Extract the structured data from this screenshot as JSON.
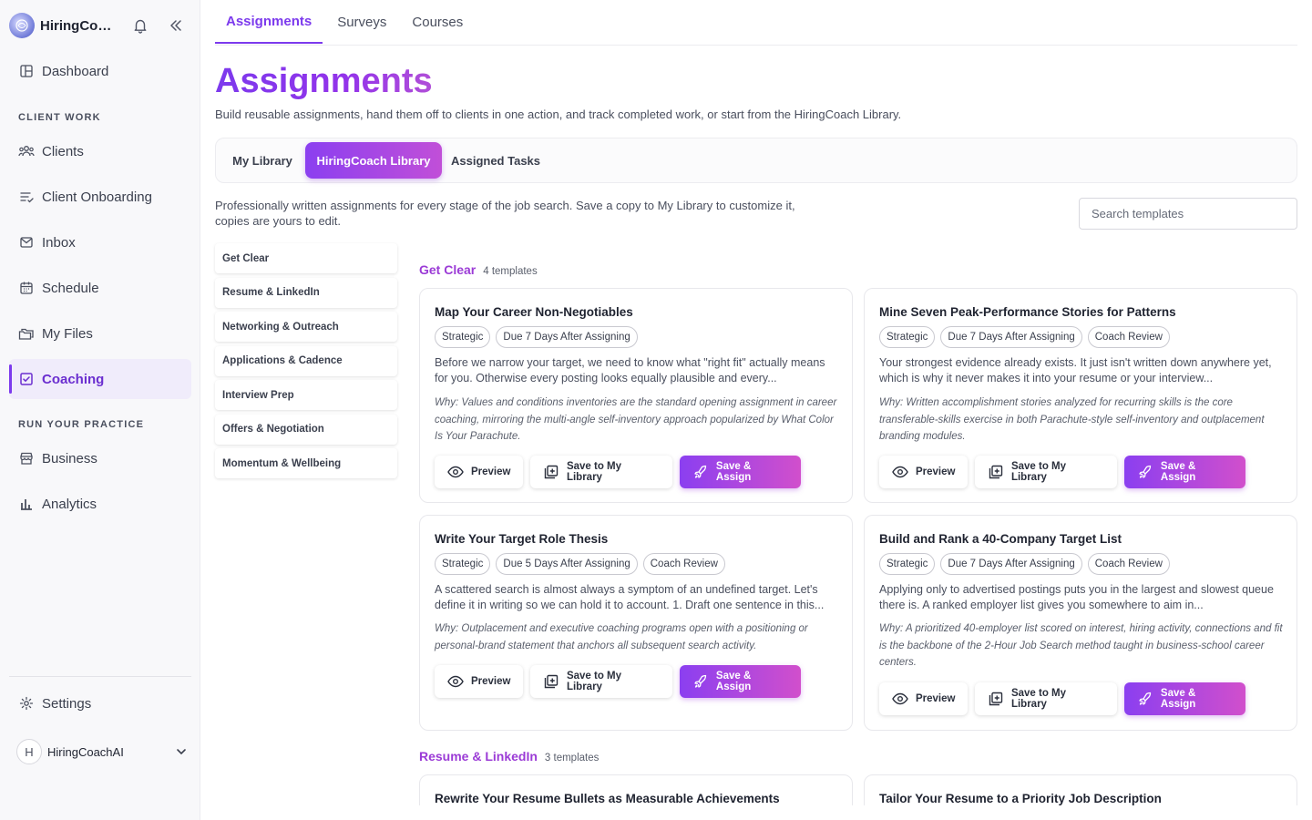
{
  "app": {
    "name": "HiringCoachAI"
  },
  "sidebar": {
    "dashboard": "Dashboard",
    "section_client": "CLIENT WORK",
    "clients": "Clients",
    "onboarding": "Client Onboarding",
    "inbox": "Inbox",
    "schedule": "Schedule",
    "files": "My Files",
    "coaching": "Coaching",
    "section_practice": "RUN YOUR PRACTICE",
    "business": "Business",
    "analytics": "Analytics",
    "settings": "Settings",
    "user_initial": "H",
    "user_name": "HiringCoachAI"
  },
  "tabs": {
    "assignments": "Assignments",
    "surveys": "Surveys",
    "courses": "Courses"
  },
  "page": {
    "title": "Assignments",
    "subtitle": "Build reusable assignments, hand them off to clients in one action, and track completed work, or start from the HiringCoach Library."
  },
  "segments": {
    "my_library": "My Library",
    "hc_library": "HiringCoach Library",
    "assigned": "Assigned Tasks"
  },
  "library": {
    "description": "Professionally written assignments for every stage of the job search. Save a copy to My Library to customize it, copies are yours to edit.",
    "search_placeholder": "Search templates"
  },
  "categories": [
    "Get Clear",
    "Resume & LinkedIn",
    "Networking & Outreach",
    "Applications & Cadence",
    "Interview Prep",
    "Offers & Negotiation",
    "Momentum & Wellbeing"
  ],
  "groups": [
    {
      "title": "Get Clear",
      "count": "4 templates"
    },
    {
      "title": "Resume & LinkedIn",
      "count": "3 templates"
    }
  ],
  "actions": {
    "preview": "Preview",
    "save": "Save to My Library",
    "assign": "Save & Assign"
  },
  "cards": [
    {
      "title": "Map Your Career Non-Negotiables",
      "tags": [
        "Strategic",
        "Due 7 Days After Assigning"
      ],
      "desc": "Before we narrow your target, we need to know what \"right fit\" actually means for you. Otherwise every posting looks equally plausible and every...",
      "why": "Why: Values and conditions inventories are the standard opening assignment in career coaching, mirroring the multi-angle self-inventory approach popularized by What Color Is Your Parachute."
    },
    {
      "title": "Mine Seven Peak-Performance Stories for Patterns",
      "tags": [
        "Strategic",
        "Due 7 Days After Assigning",
        "Coach Review"
      ],
      "desc": "Your strongest evidence already exists. It just isn't written down anywhere yet, which is why it never makes it into your resume or your interview...",
      "why": "Why: Written accomplishment stories analyzed for recurring skills is the core transferable-skills exercise in both Parachute-style self-inventory and outplacement branding modules."
    },
    {
      "title": "Write Your Target Role Thesis",
      "tags": [
        "Strategic",
        "Due 5 Days After Assigning",
        "Coach Review"
      ],
      "desc": "A scattered search is almost always a symptom of an undefined target. Let's define it in writing so we can hold it to account. 1. Draft one sentence in this...",
      "why": "Why: Outplacement and executive coaching programs open with a positioning or personal-brand statement that anchors all subsequent search activity."
    },
    {
      "title": "Build and Rank a 40-Company Target List",
      "tags": [
        "Strategic",
        "Due 7 Days After Assigning",
        "Coach Review"
      ],
      "desc": "Applying only to advertised postings puts you in the largest and slowest queue there is. A ranked employer list gives you somewhere to aim in...",
      "why": "Why: A prioritized 40-employer list scored on interest, hiring activity, connections and fit is the backbone of the 2-Hour Job Search method taught in business-school career centers."
    },
    {
      "title": "Rewrite Your Resume Bullets as Measurable Achievements"
    },
    {
      "title": "Tailor Your Resume to a Priority Job Description"
    }
  ]
}
